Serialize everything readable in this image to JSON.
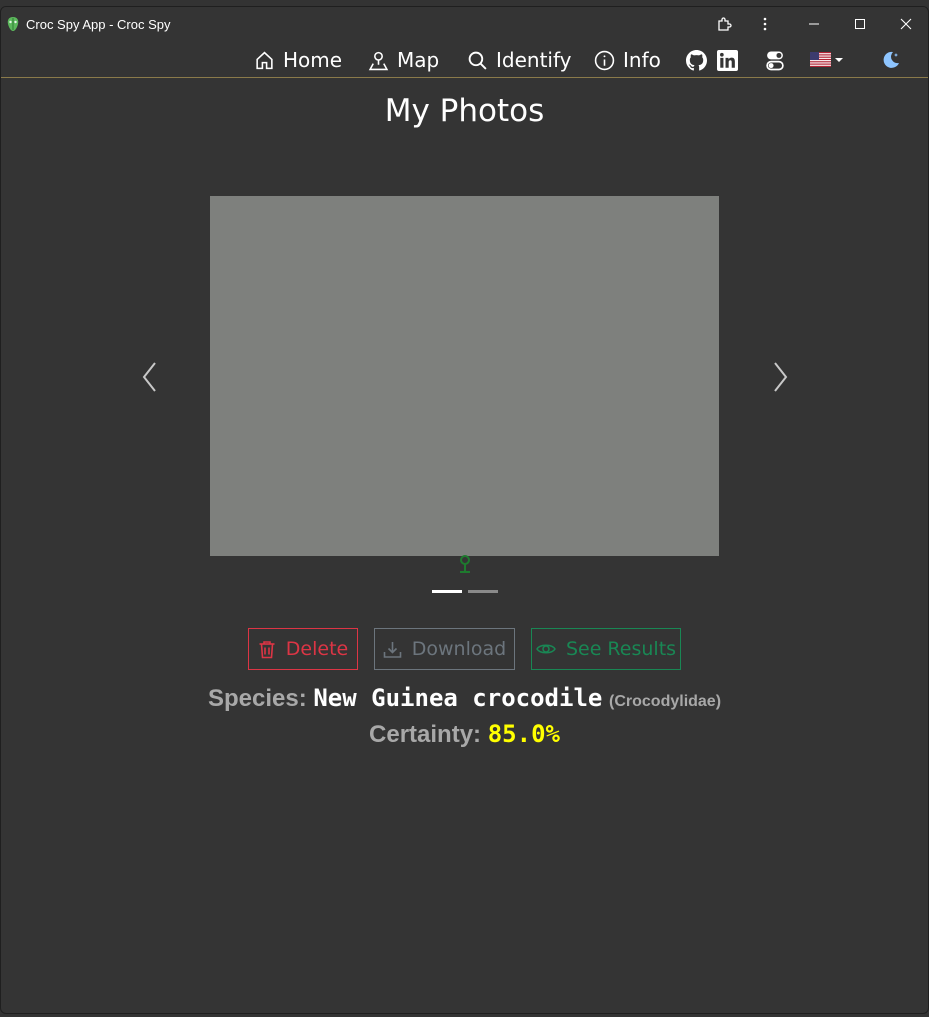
{
  "window": {
    "title": "Croc Spy App - Croc Spy"
  },
  "nav": {
    "items": [
      {
        "label": "Home",
        "icon": "home-icon"
      },
      {
        "label": "Map",
        "icon": "map-pin-person-icon"
      },
      {
        "label": "Identify",
        "icon": "search-icon"
      },
      {
        "label": "Info",
        "icon": "info-icon"
      }
    ],
    "extra_icons": [
      "github-icon",
      "linkedin-icon",
      "toggle-icon",
      "us-flag-icon",
      "moon-icon"
    ]
  },
  "page": {
    "title": "My Photos"
  },
  "carousel": {
    "slide_count": 2,
    "active_index": 0
  },
  "actions": {
    "delete_label": "Delete",
    "download_label": "Download",
    "results_label": "See Results"
  },
  "result": {
    "species_label": "Species:",
    "species_name": "New Guinea crocodile",
    "family": "(Crocodylidae)",
    "certainty_label": "Certainty:",
    "certainty_value": "85.0%"
  },
  "colors": {
    "background": "#333333",
    "delete": "#dc3545",
    "download": "#6c757d",
    "results": "#198754",
    "certainty": "#ffff00"
  }
}
